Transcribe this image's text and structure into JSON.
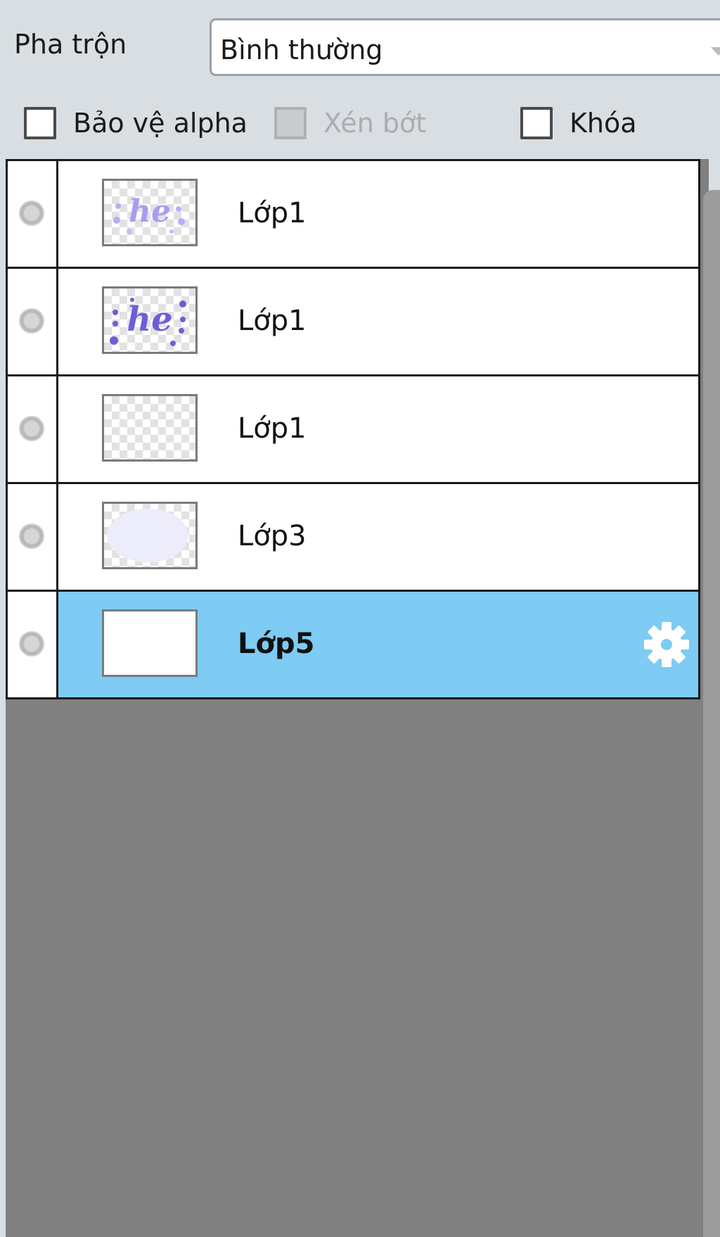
{
  "blend": {
    "label": "Pha trộn",
    "value": "Bình thường"
  },
  "options": {
    "protect_alpha": {
      "label": "Bảo vệ alpha",
      "checked": false,
      "enabled": true
    },
    "clip": {
      "label": "Xén bớt",
      "checked": false,
      "enabled": false
    },
    "lock": {
      "label": "Khóa",
      "checked": false,
      "enabled": true
    }
  },
  "layers": [
    {
      "name": "Lớp1",
      "thumbnail": "lettering-light",
      "selected": false
    },
    {
      "name": "Lớp1",
      "thumbnail": "lettering-dark",
      "selected": false
    },
    {
      "name": "Lớp1",
      "thumbnail": "transparent",
      "selected": false
    },
    {
      "name": "Lớp3",
      "thumbnail": "pale-blob",
      "selected": false
    },
    {
      "name": "Lớp5",
      "thumbnail": "white",
      "selected": true
    }
  ],
  "colors": {
    "selected_row": "#7ecbf4",
    "panel_empty": "#808080",
    "background": "#d9dee2"
  },
  "icons": {
    "layer_settings": "gear-icon",
    "visibility": "visibility-dot-icon"
  }
}
